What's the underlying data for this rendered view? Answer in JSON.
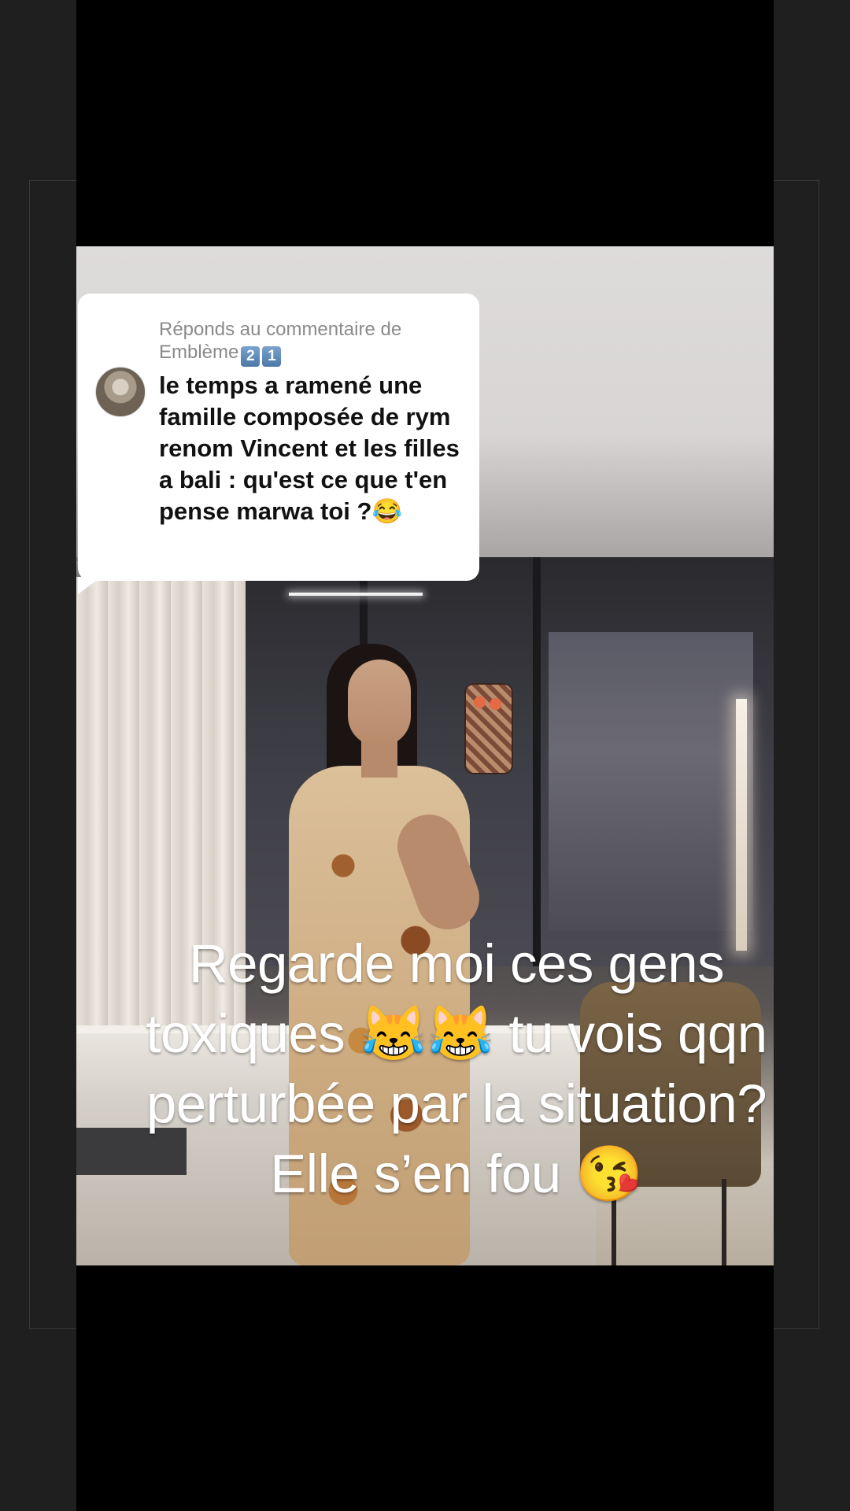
{
  "comment": {
    "reply_prefix": "Réponds au commentaire de",
    "username": "Emblème",
    "username_badges": [
      "2",
      "1"
    ],
    "text": "le temps a ramené une famille composée de rym renom Vincent et les filles a bali : qu'est ce que t'en pense marwa toi ?😂"
  },
  "caption": {
    "line1": "Regarde moi ces gens",
    "line2": "toxiques 😹😹 tu vois qqn",
    "line3": "perturbée par la situation?",
    "line4": "Elle s’en fou 😘"
  },
  "colors": {
    "page_bg": "#1f1f1f",
    "video_letterbox": "#000000",
    "bubble_bg": "#ffffff",
    "caption_text": "#ffffff"
  }
}
